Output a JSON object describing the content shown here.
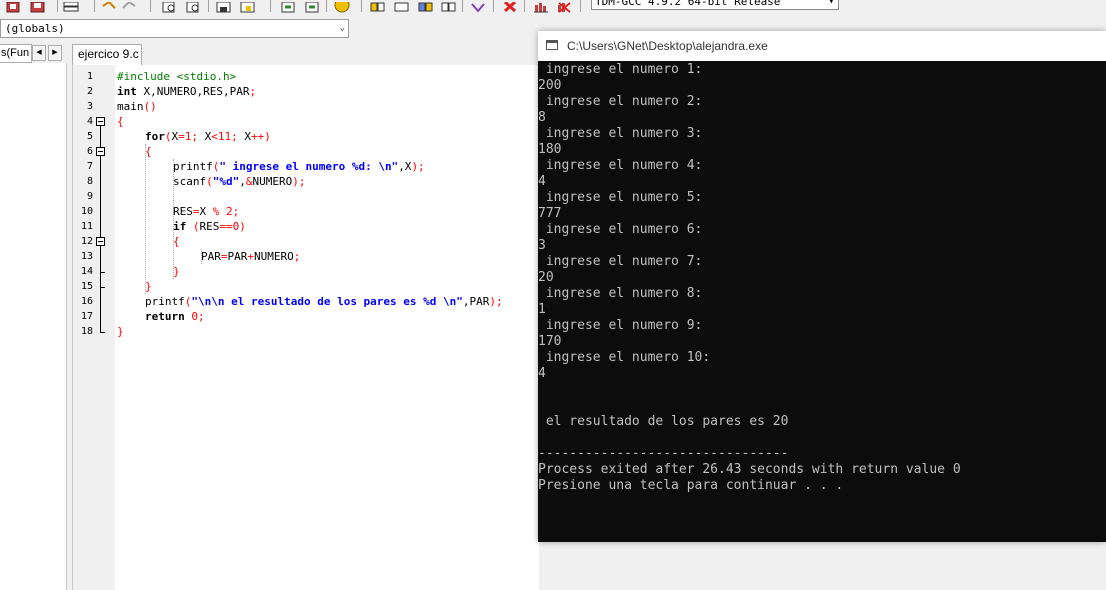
{
  "toolbar": {
    "compiler_select": "TDM-GCC 4.9.2 64-bit Release",
    "icons": [
      "compile-icon",
      "run-icon",
      "rebuild-icon",
      "debug-icon",
      "undo-icon",
      "redo-icon",
      "find-icon",
      "replace-icon",
      "save-icon",
      "new-icon",
      "goto-icon",
      "bookmark-icon",
      "smiley-icon",
      "layout-icon",
      "layout2-icon",
      "layout3-icon",
      "layout4-icon",
      "class-icon",
      "stop-icon",
      "chart-icon",
      "delete-chart-icon"
    ]
  },
  "globals": {
    "value": "(globals)"
  },
  "left_panel": {
    "tab_label": "s(Fun"
  },
  "editor": {
    "tab_label": "ejercico 9.c",
    "lines": [
      {
        "n": "1"
      },
      {
        "n": "2"
      },
      {
        "n": "3"
      },
      {
        "n": "4"
      },
      {
        "n": "5"
      },
      {
        "n": "6"
      },
      {
        "n": "7"
      },
      {
        "n": "8"
      },
      {
        "n": "9"
      },
      {
        "n": "10"
      },
      {
        "n": "11"
      },
      {
        "n": "12"
      },
      {
        "n": "13"
      },
      {
        "n": "14"
      },
      {
        "n": "15"
      },
      {
        "n": "16"
      },
      {
        "n": "17"
      },
      {
        "n": "18"
      }
    ],
    "code": {
      "l1": "#include <stdio.h>",
      "l2a": "int",
      "l2b": " X,NUMERO,RES,PAR",
      "l2c": ";",
      "l3a": "main",
      "l3b": "()",
      "l4": "{",
      "l5a": "for",
      "l5b": "(",
      "l5c": "X",
      "l5d": "=",
      "l5e": "1",
      "l5f": "; ",
      "l5g": "X",
      "l5h": "<",
      "l5i": "11",
      "l5j": "; ",
      "l5k": "X",
      "l5l": "++",
      "l5m": ")",
      "l6": "{",
      "l7a": "printf",
      "l7b": "(",
      "l7c": "\" ingrese el numero %d: \\n\"",
      "l7d": ",X",
      "l7e": ");",
      "l8a": "scanf",
      "l8b": "(",
      "l8c": "\"%d\"",
      "l8d": ",",
      "l8e": "&",
      "l8f": "NUMERO",
      "l8g": ");",
      "l10a": "RES",
      "l10b": "=",
      "l10c": "X ",
      "l10d": "%",
      "l10e": " ",
      "l10f": "2",
      "l10g": ";",
      "l11a": "if",
      "l11b": " (",
      "l11c": "RES",
      "l11d": "==",
      "l11e": "0",
      "l11f": ")",
      "l12": "{",
      "l13a": "PAR",
      "l13b": "=",
      "l13c": "PAR",
      "l13d": "+",
      "l13e": "NUMERO",
      "l13f": ";",
      "l14": "}",
      "l15": "}",
      "l16a": "printf",
      "l16b": "(",
      "l16c": "\"\\n\\n el resultado de los pares es %d \\n\"",
      "l16d": ",PAR",
      "l16e": ");",
      "l17a": "return",
      "l17b": " ",
      "l17c": "0",
      "l17d": ";",
      "l18": "}"
    }
  },
  "console": {
    "title": "C:\\Users\\GNet\\Desktop\\alejandra.exe",
    "lines": [
      " ingrese el numero 1:",
      "200",
      " ingrese el numero 2:",
      "8",
      " ingrese el numero 3:",
      "180",
      " ingrese el numero 4:",
      "4",
      " ingrese el numero 5:",
      "777",
      " ingrese el numero 6:",
      "3",
      " ingrese el numero 7:",
      "20",
      " ingrese el numero 8:",
      "1",
      " ingrese el numero 9:",
      "170",
      " ingrese el numero 10:",
      "4",
      "",
      "",
      "",
      " el resultado de los pares es 20",
      "",
      "--------------------------------",
      "Process exited after 26.43 seconds with return value 0",
      "Presione una tecla para continuar . . ."
    ]
  },
  "colors": {
    "keyword": "#000000",
    "preprocessor": "#008000",
    "string": "#0000ff",
    "number": "#ff0000",
    "highlight_line": "#ccffff",
    "console_bg": "#0c0c0c",
    "console_fg": "#c0c0c0"
  }
}
